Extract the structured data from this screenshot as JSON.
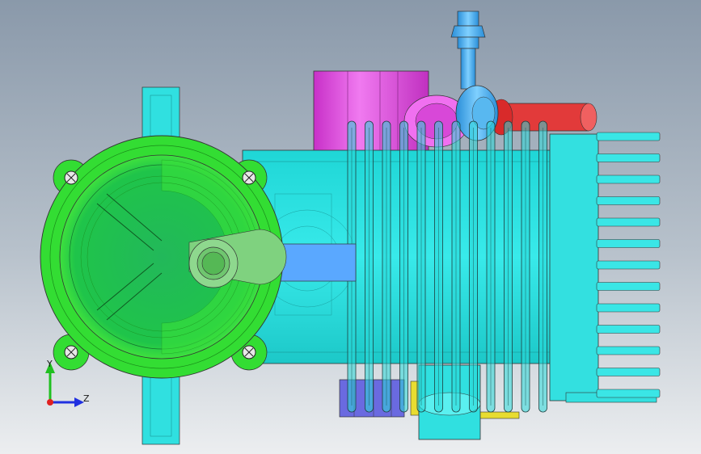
{
  "viewport": {
    "background_top": "#8c9bab",
    "background_bottom": "#e8ebee"
  },
  "model": {
    "parts": [
      {
        "name": "housing-body",
        "color": "#2ee6e6"
      },
      {
        "name": "motor-cover",
        "color": "#22dd22"
      },
      {
        "name": "intake-port",
        "color": "#e040e0"
      },
      {
        "name": "nozzle-fitting",
        "color": "#3ab0e8"
      },
      {
        "name": "outlet-pipe",
        "color": "#e03030"
      },
      {
        "name": "drive-shaft",
        "color": "#5aa8ff"
      },
      {
        "name": "lower-block",
        "color": "#7070e0"
      },
      {
        "name": "bracket-accent",
        "color": "#f0e030"
      }
    ]
  },
  "triad": {
    "y_label": "Y",
    "z_label": "Z",
    "y_color": "#20c020",
    "z_color": "#2030e0",
    "origin_color": "#e02020"
  }
}
